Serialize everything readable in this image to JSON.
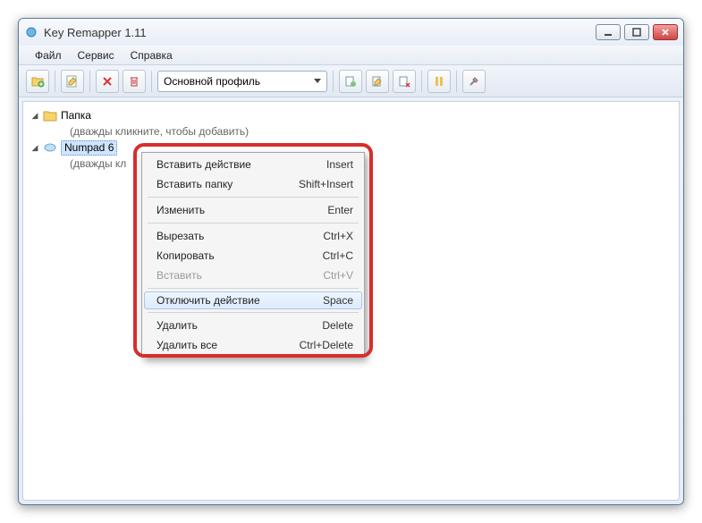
{
  "window": {
    "title": "Key Remapper 1.11"
  },
  "menubar": {
    "file": "Файл",
    "service": "Сервис",
    "help": "Справка"
  },
  "toolbar": {
    "profile_value": "Основной профиль"
  },
  "tree": {
    "folder_label": "Папка",
    "folder_hint": "(дважды кликните, чтобы добавить)",
    "selected_key": "Numpad 6",
    "selected_hint": "(дважды кл"
  },
  "context_menu": {
    "insert_action": {
      "label": "Вставить действие",
      "shortcut": "Insert"
    },
    "insert_folder": {
      "label": "Вставить папку",
      "shortcut": "Shift+Insert"
    },
    "edit": {
      "label": "Изменить",
      "shortcut": "Enter"
    },
    "cut": {
      "label": "Вырезать",
      "shortcut": "Ctrl+X"
    },
    "copy": {
      "label": "Копировать",
      "shortcut": "Ctrl+C"
    },
    "paste": {
      "label": "Вставить",
      "shortcut": "Ctrl+V"
    },
    "disable_action": {
      "label": "Отключить действие",
      "shortcut": "Space"
    },
    "delete": {
      "label": "Удалить",
      "shortcut": "Delete"
    },
    "delete_all": {
      "label": "Удалить все",
      "shortcut": "Ctrl+Delete"
    }
  }
}
